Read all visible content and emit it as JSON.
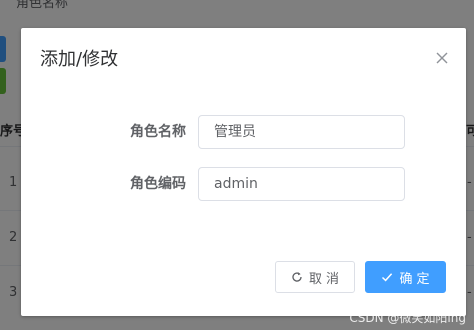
{
  "background": {
    "search_label": "角色名称",
    "table_header_index": "序号",
    "table_header_right": "可",
    "rows": [
      {
        "num": "1",
        "right": "-"
      },
      {
        "num": "2",
        "right": "-"
      },
      {
        "num": "3",
        "right": "-"
      }
    ]
  },
  "dialog": {
    "title": "添加/修改",
    "fields": [
      {
        "label": "角色名称",
        "value": "管理员"
      },
      {
        "label": "角色编码",
        "value": "admin"
      }
    ],
    "cancel_label": "取消",
    "confirm_label": "确定"
  },
  "watermark": "CSDN @微笑如阳ing",
  "colors": {
    "primary": "#409eff",
    "success": "#67c23a",
    "mask": "rgba(0,0,0,0.5)"
  },
  "icons": {
    "close": "close-icon",
    "cancel": "refresh-icon",
    "confirm": "check-icon"
  }
}
